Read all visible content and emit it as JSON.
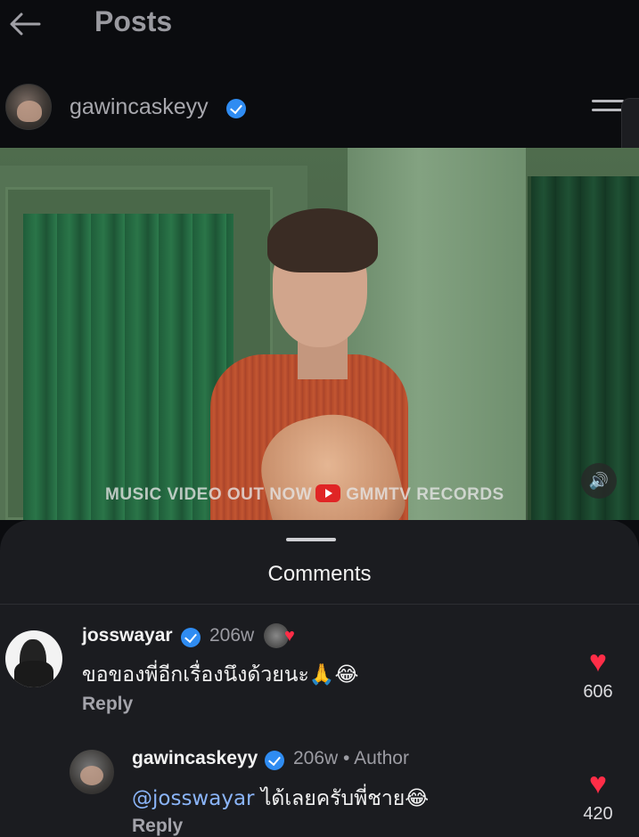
{
  "header": {
    "title": "Posts",
    "back_icon": "arrow-left-icon"
  },
  "post": {
    "username": "gawincaskeyy",
    "verified": true,
    "video_watermark_left": "MUSIC VIDEO OUT NOW",
    "video_watermark_right": "GMMTV RECORDS",
    "sound_icon": "speaker-icon"
  },
  "comments_sheet": {
    "title": "Comments",
    "comments": [
      {
        "username": "josswayar",
        "verified": true,
        "time": "206w",
        "text": "ขอของพี่อีกเรื่องนึงด้วยนะ🙏😂",
        "reply_label": "Reply",
        "likes": "606",
        "liked_by_author": true
      },
      {
        "username": "gawincaskeyy",
        "verified": true,
        "time": "206w",
        "author_label": "Author",
        "separator": "•",
        "mention": "@josswayar",
        "text": "ได้เลยครับพี่ชาย😂",
        "reply_label": "Reply",
        "likes": "420"
      }
    ]
  },
  "colors": {
    "accent_blue": "#2f8cf2",
    "heart_red": "#ff2d47",
    "background": "#0b0c0f",
    "sheet": "#1b1c20"
  }
}
